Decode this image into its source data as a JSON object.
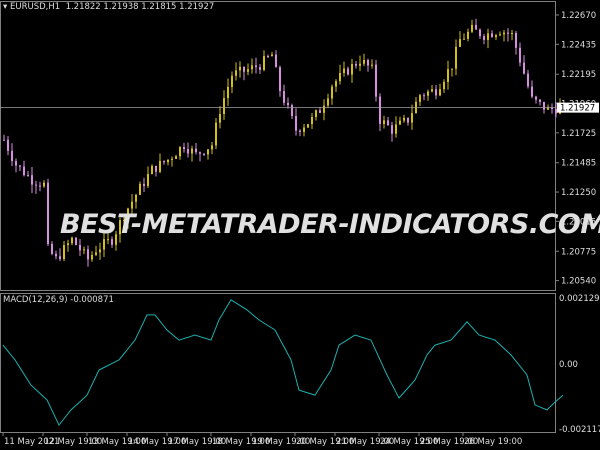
{
  "header": {
    "symbol": "EURUSD,H1",
    "ohlc": "1.21822 1.21938 1.21815 1.21927"
  },
  "watermark": "BEST-METATRADER-INDICATORS.COM",
  "colors": {
    "bull": "#d4c015",
    "bear": "#d88ee0",
    "macd": "#1bb1b1",
    "grid": "#808080",
    "bg": "#000000"
  },
  "chart_data": [
    {
      "type": "candlestick",
      "title": "EURUSD,H1",
      "current_price": 1.21927,
      "current_price_label": "1.21927",
      "ylim": [
        1.2042,
        1.2282
      ],
      "yticks": [
        "1.22670",
        "1.22435",
        "1.22195",
        "1.21960",
        "1.21725",
        "1.21485",
        "1.21250",
        "1.21015",
        "1.20775",
        "1.20540"
      ],
      "ytick_values": [
        1.2267,
        1.22435,
        1.22195,
        1.2196,
        1.21725,
        1.21485,
        1.2125,
        1.21015,
        1.20775,
        1.2054
      ],
      "close_keypoints": [
        [
          0,
          1.2167
        ],
        [
          3,
          1.2147
        ],
        [
          7,
          1.2135
        ],
        [
          10,
          1.2131
        ],
        [
          11,
          1.2079
        ],
        [
          13,
          1.2071
        ],
        [
          17,
          1.2087
        ],
        [
          21,
          1.2071
        ],
        [
          23,
          1.2079
        ],
        [
          27,
          1.2087
        ],
        [
          30,
          1.2107
        ],
        [
          33,
          1.2123
        ],
        [
          37,
          1.2143
        ],
        [
          41,
          1.2151
        ],
        [
          45,
          1.2163
        ],
        [
          48,
          1.2155
        ],
        [
          52,
          1.2163
        ],
        [
          54,
          1.2191
        ],
        [
          57,
          1.2219
        ],
        [
          61,
          1.2223
        ],
        [
          64,
          1.2227
        ],
        [
          67,
          1.2235
        ],
        [
          69,
          1.2207
        ],
        [
          73,
          1.2175
        ],
        [
          77,
          1.2183
        ],
        [
          79,
          1.2191
        ],
        [
          82,
          1.2211
        ],
        [
          86,
          1.2223
        ],
        [
          89,
          1.2231
        ],
        [
          92,
          1.2223
        ],
        [
          94,
          1.2183
        ],
        [
          97,
          1.2175
        ],
        [
          101,
          1.2183
        ],
        [
          104,
          1.2203
        ],
        [
          108,
          1.2207
        ],
        [
          112,
          1.2227
        ],
        [
          114,
          1.2247
        ],
        [
          117,
          1.2255
        ],
        [
          120,
          1.2251
        ],
        [
          124,
          1.2255
        ],
        [
          127,
          1.2251
        ],
        [
          129,
          1.2231
        ],
        [
          132,
          1.2199
        ],
        [
          136,
          1.2191
        ],
        [
          139,
          1.2193
        ]
      ]
    },
    {
      "type": "line",
      "title": "MACD(12,26,9) -0.000871",
      "ylim": [
        -0.002117,
        0.002129
      ],
      "yticks": [
        "0.002129",
        "0.00",
        "-0.002117"
      ],
      "ytick_values": [
        0.002129,
        0,
        -0.002117
      ],
      "keypoints": [
        [
          0,
          0.0006
        ],
        [
          3,
          0.00013
        ],
        [
          7,
          -0.00067
        ],
        [
          11,
          -0.00114
        ],
        [
          14,
          -0.00194
        ],
        [
          17,
          -0.00146
        ],
        [
          21,
          -0.00099
        ],
        [
          24,
          -0.00019
        ],
        [
          29,
          0.00013
        ],
        [
          33,
          0.00076
        ],
        [
          36,
          0.00156
        ],
        [
          38,
          0.00156
        ],
        [
          41,
          0.00108
        ],
        [
          44,
          0.00076
        ],
        [
          48,
          0.00092
        ],
        [
          52,
          0.00076
        ],
        [
          54,
          0.0014
        ],
        [
          57,
          0.00204
        ],
        [
          61,
          0.00172
        ],
        [
          64,
          0.0014
        ],
        [
          68,
          0.00108
        ],
        [
          72,
          0.00013
        ],
        [
          74,
          -0.00083
        ],
        [
          78,
          -0.00099
        ],
        [
          82,
          -0.00019
        ],
        [
          84,
          0.0006
        ],
        [
          88,
          0.00092
        ],
        [
          92,
          0.00076
        ],
        [
          96,
          -0.00035
        ],
        [
          99,
          -0.00108
        ],
        [
          103,
          -0.00051
        ],
        [
          106,
          0.00029
        ],
        [
          108,
          0.0006
        ],
        [
          112,
          0.00076
        ],
        [
          116,
          0.00134
        ],
        [
          119,
          0.00092
        ],
        [
          123,
          0.00076
        ],
        [
          127,
          0.00029
        ],
        [
          131,
          -0.00035
        ],
        [
          133,
          -0.0013
        ],
        [
          136,
          -0.00146
        ],
        [
          138,
          -0.00121
        ],
        [
          140,
          -0.00099
        ]
      ]
    }
  ],
  "xaxis": {
    "labels": [
      "11 May 2021",
      "12 May 19:00",
      "13 May 19:00",
      "14 May 19:00",
      "17 May 19:00",
      "18 May 19:00",
      "19 May 19:00",
      "20 May 19:00",
      "21 May 19:00",
      "24 May 19:00",
      "25 May 19:00",
      "26 May 19:00"
    ],
    "label_bars": [
      0,
      10,
      21,
      31,
      41,
      52,
      62,
      73,
      83,
      94,
      104,
      115
    ]
  }
}
